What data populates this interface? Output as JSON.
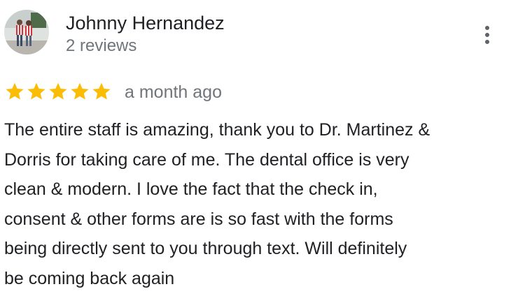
{
  "reviewer": {
    "name": "Johnny Hernandez",
    "review_count": "2 reviews"
  },
  "review": {
    "rating": 5,
    "max_rating": 5,
    "date": "a month ago",
    "text_lines": [
      "The entire staff is amazing, thank you to Dr. Martinez &",
      "Dorris for taking care of me. The dental office is very",
      "clean & modern. I love the fact that the check in,",
      "consent & other forms are is so fast with the forms",
      "being directly sent to you through text. Will definitely",
      "be coming back again"
    ]
  },
  "icons": {
    "more": "more-vert-icon",
    "star": "star-icon"
  },
  "colors": {
    "star": "#fbbc04",
    "name": "#202124",
    "secondary": "#70757a",
    "icon": "#5f6368"
  }
}
